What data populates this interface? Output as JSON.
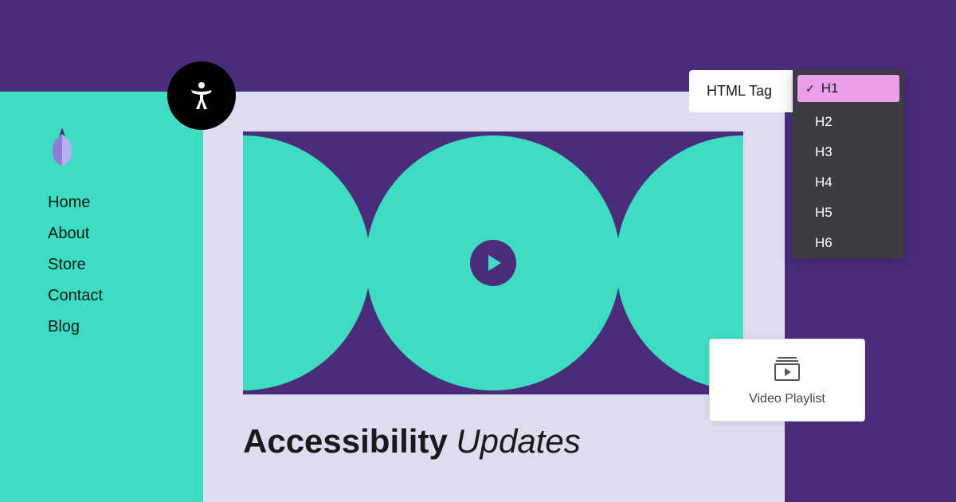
{
  "sidebar": {
    "nav": [
      {
        "label": "Home"
      },
      {
        "label": "About"
      },
      {
        "label": "Store"
      },
      {
        "label": "Contact"
      },
      {
        "label": "Blog"
      }
    ]
  },
  "content": {
    "heading_bold": "Accessibility",
    "heading_italic": "Updates"
  },
  "html_tag_panel": {
    "label": "HTML Tag",
    "options": [
      {
        "label": "H1",
        "selected": true
      },
      {
        "label": "H2",
        "selected": false
      },
      {
        "label": "H3",
        "selected": false
      },
      {
        "label": "H4",
        "selected": false
      },
      {
        "label": "H5",
        "selected": false
      },
      {
        "label": "H6",
        "selected": false
      }
    ]
  },
  "video_playlist_card": {
    "label": "Video Playlist"
  }
}
